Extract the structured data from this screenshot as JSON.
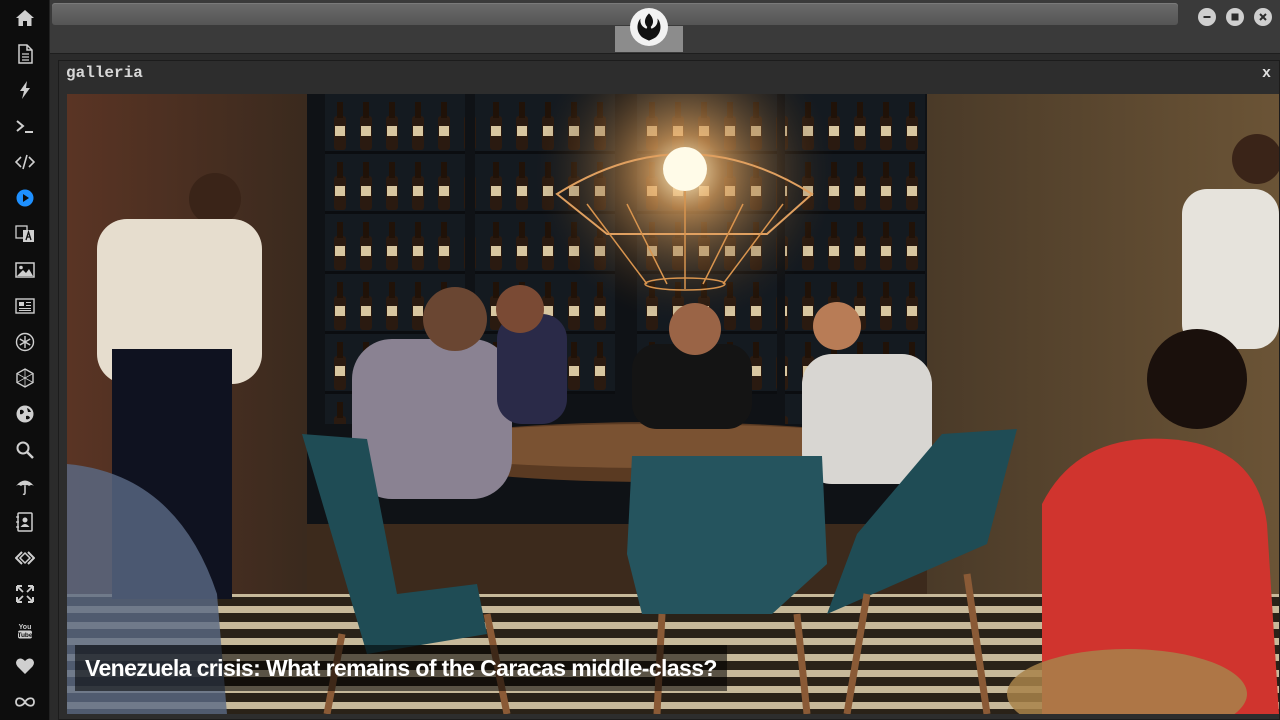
{
  "dock": {
    "items": [
      {
        "name": "home-icon"
      },
      {
        "name": "document-icon"
      },
      {
        "name": "bolt-icon"
      },
      {
        "name": "terminal-icon"
      },
      {
        "name": "code-icon"
      },
      {
        "name": "play-icon",
        "active": true
      },
      {
        "name": "translate-icon"
      },
      {
        "name": "image-icon"
      },
      {
        "name": "newspaper-icon"
      },
      {
        "name": "snowflake-icon"
      },
      {
        "name": "hexagon-icon"
      },
      {
        "name": "globe-icon"
      },
      {
        "name": "search-icon"
      },
      {
        "name": "umbrella-icon"
      },
      {
        "name": "contacts-icon"
      },
      {
        "name": "share-icon"
      },
      {
        "name": "fullscreen-icon"
      },
      {
        "name": "youtube-icon"
      },
      {
        "name": "heart-icon"
      },
      {
        "name": "infinity-icon"
      }
    ],
    "accent": "#1e90ff"
  },
  "window": {
    "logo": "rebel-alliance-icon"
  },
  "panel": {
    "title": "galleria",
    "close_label": "x"
  },
  "gallery": {
    "caption": "Venezuela crisis: What remains of the Caracas middle-class?"
  }
}
